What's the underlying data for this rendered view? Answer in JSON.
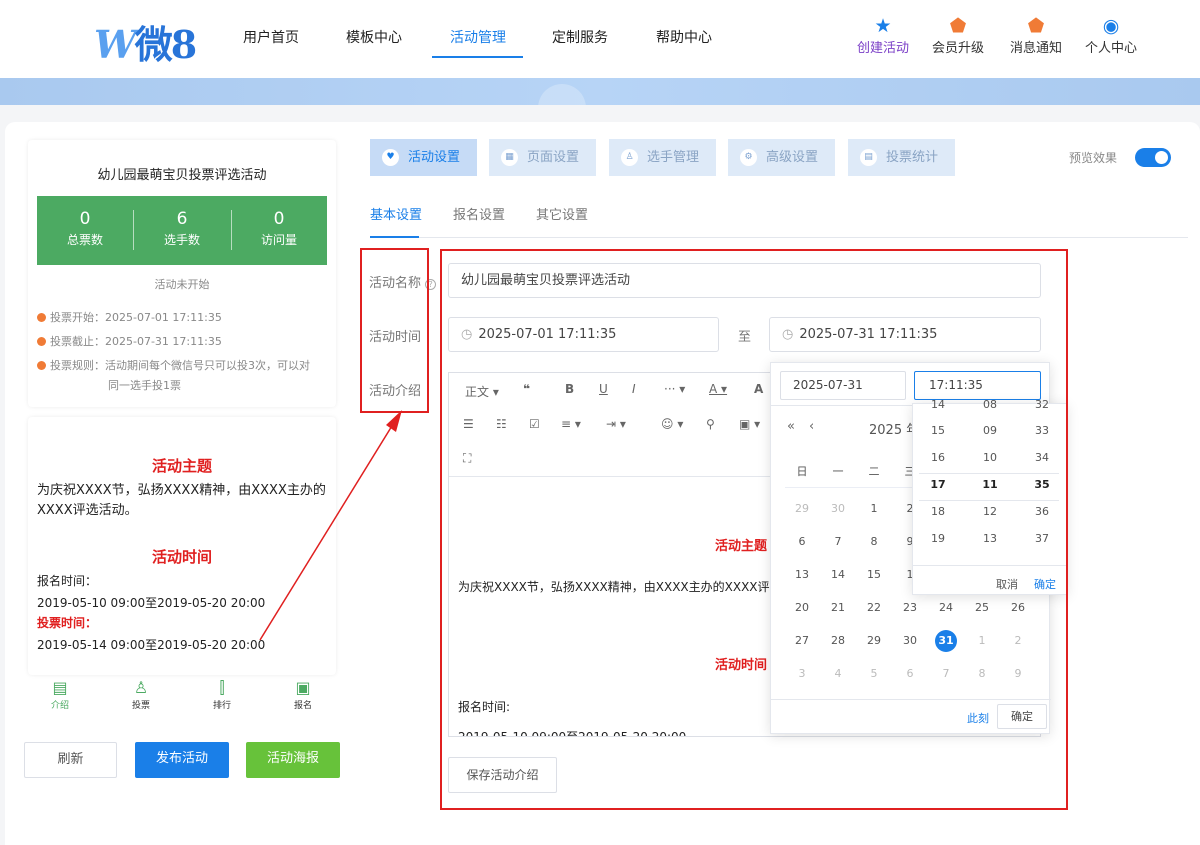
{
  "header": {
    "logo_w": "W",
    "logo_text": "微8",
    "nav": [
      "用户首页",
      "模板中心",
      "活动管理",
      "定制服务",
      "帮助中心"
    ],
    "actions": [
      {
        "label": "创建活动",
        "icon": "star-icon",
        "color": "#7b3fc7"
      },
      {
        "label": "会员升级",
        "icon": "shield-icon",
        "color": "#f07b36"
      },
      {
        "label": "消息通知",
        "icon": "bell-icon",
        "color": "#f07b36"
      },
      {
        "label": "个人中心",
        "icon": "user-icon",
        "color": "#1a7fe8"
      }
    ]
  },
  "preview": {
    "title": "幼儿园最萌宝贝投票评选活动",
    "stats": [
      {
        "value": "0",
        "label": "总票数"
      },
      {
        "value": "6",
        "label": "选手数"
      },
      {
        "value": "0",
        "label": "访问量"
      }
    ],
    "status": "活动未开始",
    "vote_start": "投票开始：2025-07-01 17:11:35",
    "vote_end": "投票截止：2025-07-31 17:11:35",
    "vote_rule": "投票规则：活动期间每个微信号只可以投3次，可以对",
    "vote_rule_2": "同一选手投1票",
    "theme_heading": "活动主题",
    "theme_text": "为庆祝XXXX节，弘扬XXXX精神，由XXXX主办的XXXX评选活动。",
    "time_heading": "活动时间",
    "signup_label": "报名时间：",
    "signup_time": "2019-05-10 09:00至2019-05-20 20:00",
    "vote_label": "投票时间：",
    "vote_time": "2019-05-14 09:00至2019-05-20 20:00",
    "tabs": [
      "介绍",
      "投票",
      "排行",
      "报名"
    ],
    "buttons": {
      "refresh": "刷新",
      "publish": "发布活动",
      "poster": "活动海报"
    }
  },
  "settings": {
    "top_tabs": [
      "活动设置",
      "页面设置",
      "选手管理",
      "高级设置",
      "投票统计"
    ],
    "preview_label": "预览效果",
    "preview_on": true,
    "sub_tabs": [
      "基本设置",
      "报名设置",
      "其它设置"
    ],
    "labels": {
      "name": "活动名称",
      "time": "活动时间",
      "intro": "活动介绍"
    },
    "name_value": "幼儿园最萌宝贝投票评选活动",
    "start_time": "2025-07-01 17:11:35",
    "to": "至",
    "end_time": "2025-07-31 17:11:35",
    "editor": {
      "toolbar_para": "正文",
      "theme_heading": "活动主题",
      "theme_text": "为庆祝XXXX节，弘扬XXXX精神，由XXXX主办的XXXX评",
      "time_heading": "活动时间",
      "signup_label": "报名时间:",
      "signup_time": "2019-05-10 09:00至2019-05-20 20:00"
    },
    "save_button": "保存活动介绍"
  },
  "datepicker": {
    "date_value": "2025-07-31",
    "time_value": "17:11:35",
    "header": "2025 年",
    "weekdays": [
      "日",
      "一",
      "二",
      "三"
    ],
    "rows": [
      [
        "29",
        "30",
        "1",
        "2"
      ],
      [
        "6",
        "7",
        "8",
        "9"
      ],
      [
        "13",
        "14",
        "15",
        "1"
      ],
      [
        "20",
        "21",
        "22",
        "23",
        "24",
        "25",
        "26"
      ],
      [
        "27",
        "28",
        "29",
        "30",
        "31",
        "1",
        "2"
      ],
      [
        "3",
        "4",
        "5",
        "6",
        "7",
        "8",
        "9"
      ]
    ],
    "now": "此刻",
    "confirm": "确定",
    "time_panel": {
      "rows": [
        [
          "14",
          "08",
          "32"
        ],
        [
          "15",
          "09",
          "33"
        ],
        [
          "16",
          "10",
          "34"
        ],
        [
          "17",
          "11",
          "35"
        ],
        [
          "18",
          "12",
          "36"
        ],
        [
          "19",
          "13",
          "37"
        ]
      ],
      "cancel": "取消",
      "confirm": "确定"
    }
  }
}
